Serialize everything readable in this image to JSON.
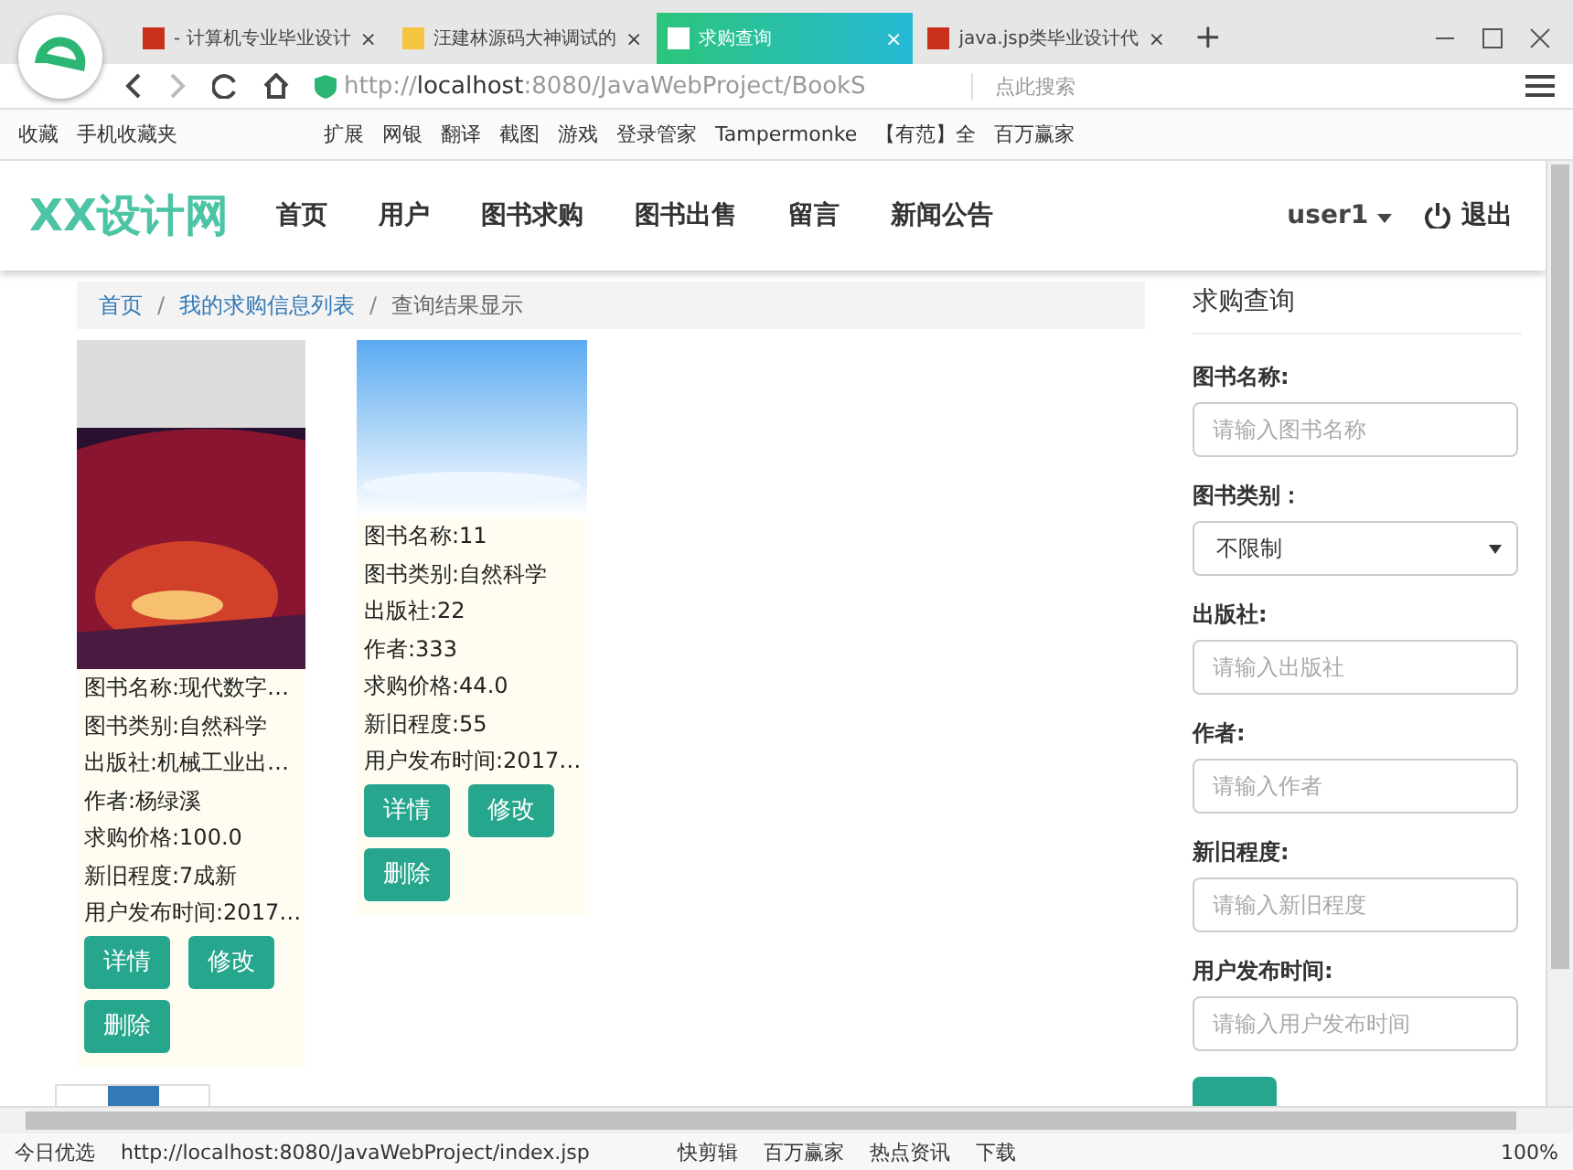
{
  "browser": {
    "tabs": [
      {
        "title": "- 计算机专业毕业设计",
        "close": "×",
        "selected": false
      },
      {
        "title": "汪建林源码大神调试的",
        "close": "×",
        "selected": false
      },
      {
        "title": "求购查询",
        "close": "×",
        "selected": true
      },
      {
        "title": "java.jsp类毕业设计代",
        "close": "×",
        "selected": false
      }
    ],
    "new_tab": "+",
    "url": "http://**localhost**:8080/JavaWebProject/BookS",
    "search_placeholder": "点此搜索",
    "bookmarks_left": [
      "收藏",
      "手机收藏夹"
    ],
    "bookmarks_right": [
      "扩展",
      "网银",
      "翻译",
      "截图",
      "游戏",
      "登录管家",
      "Tampermonke",
      "【有范】全",
      "百万赢家"
    ],
    "status_bar": {
      "left": "今日优选",
      "url": "http://localhost:8080/JavaWebProject/index.jsp",
      "items": [
        "快剪辑",
        "百万赢家",
        "热点资讯",
        "下载"
      ],
      "zoom": "100%"
    }
  },
  "navbar": {
    "brand": "XX设计网",
    "items": [
      "首页",
      "用户",
      "图书求购",
      "图书出售",
      "留言",
      "新闻公告"
    ],
    "user": "user1",
    "logout": "退出"
  },
  "breadcrumb": {
    "separator": "/",
    "items": [
      {
        "label": "首页",
        "link": true
      },
      {
        "label": "我的求购信息列表",
        "link": true
      },
      {
        "label": "查询结果显示",
        "link": false
      }
    ]
  },
  "cards": [
    {
      "lines": [
        "图书名称:现代数字…",
        "图书类别:自然科学",
        "出版社:机械工业出…",
        "作者:杨绿溪",
        "求购价格:100.0",
        "新旧程度:7成新",
        "用户发布时间:2017…"
      ],
      "buttons": [
        "详情",
        "修改",
        "删除"
      ]
    },
    {
      "lines": [
        "图书名称:11",
        "图书类别:自然科学",
        "出版社:22",
        "作者:333",
        "求购价格:44.0",
        "新旧程度:55",
        "用户发布时间:2017…"
      ],
      "buttons": [
        "详情",
        "修改",
        "删除"
      ]
    }
  ],
  "sidebar": {
    "title": "求购查询",
    "fields": [
      {
        "label": "图书名称:",
        "kind": "input",
        "placeholder": "请输入图书名称"
      },
      {
        "label": "图书类别：",
        "kind": "select",
        "value": "不限制"
      },
      {
        "label": "出版社:",
        "kind": "input",
        "placeholder": "请输入出版社"
      },
      {
        "label": "作者:",
        "kind": "input",
        "placeholder": "请输入作者"
      },
      {
        "label": "新旧程度:",
        "kind": "input",
        "placeholder": "请输入新旧程度"
      },
      {
        "label": "用户发布时间:",
        "kind": "input",
        "placeholder": "请输入用户发布时间"
      }
    ]
  }
}
